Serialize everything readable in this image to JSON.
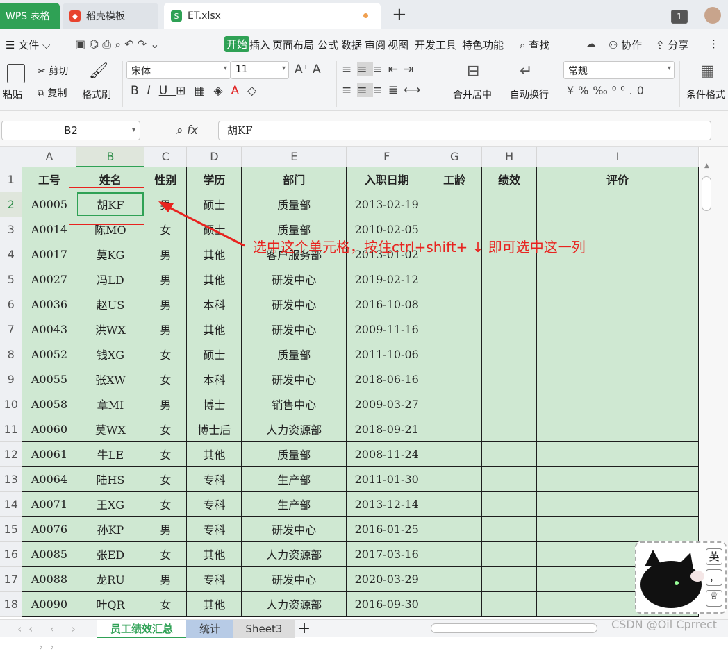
{
  "tabs": [
    {
      "label": "WPS 表格"
    },
    {
      "label": "稻壳模板"
    },
    {
      "label": "ET.xlsx"
    }
  ],
  "tab_counter": "1",
  "menu": {
    "file": "文件",
    "items": [
      "开始",
      "插入",
      "页面布局",
      "公式",
      "数据",
      "审阅",
      "视图",
      "开发工具",
      "特色功能"
    ],
    "search": "查找",
    "collab": "协作",
    "share": "分享"
  },
  "ribbon": {
    "paste": "粘贴",
    "cut": "剪切",
    "copy": "复制",
    "format_painter": "格式刷",
    "font_name": "宋体",
    "font_size": "11",
    "merge": "合并居中",
    "wrap": "自动换行",
    "number_format": "常规",
    "cond_format": "条件格式"
  },
  "formula_bar": {
    "cell_ref": "B2",
    "fx": "fx",
    "value": "胡KF"
  },
  "columns": [
    "A",
    "B",
    "C",
    "D",
    "E",
    "F",
    "G",
    "H",
    "I"
  ],
  "rows": [
    [
      "工号",
      "姓名",
      "性别",
      "学历",
      "部门",
      "入职日期",
      "工龄",
      "绩效",
      "评价"
    ],
    [
      "A0005",
      "胡KF",
      "男",
      "硕士",
      "质量部",
      "2013-02-19",
      "",
      "",
      ""
    ],
    [
      "A0014",
      "陈MO",
      "女",
      "硕士",
      "质量部",
      "2010-02-05",
      "",
      "",
      ""
    ],
    [
      "A0017",
      "莫KG",
      "男",
      "其他",
      "客户服务部",
      "2013-01-02",
      "",
      "",
      ""
    ],
    [
      "A0027",
      "冯LD",
      "男",
      "其他",
      "研发中心",
      "2019-02-12",
      "",
      "",
      ""
    ],
    [
      "A0036",
      "赵US",
      "男",
      "本科",
      "研发中心",
      "2016-10-08",
      "",
      "",
      ""
    ],
    [
      "A0043",
      "洪WX",
      "男",
      "其他",
      "研发中心",
      "2009-11-16",
      "",
      "",
      ""
    ],
    [
      "A0052",
      "钱XG",
      "女",
      "硕士",
      "质量部",
      "2011-10-06",
      "",
      "",
      ""
    ],
    [
      "A0055",
      "张XW",
      "女",
      "本科",
      "研发中心",
      "2018-06-16",
      "",
      "",
      ""
    ],
    [
      "A0058",
      "章MI",
      "男",
      "博士",
      "销售中心",
      "2009-03-27",
      "",
      "",
      ""
    ],
    [
      "A0060",
      "莫WX",
      "女",
      "博士后",
      "人力资源部",
      "2018-09-21",
      "",
      "",
      ""
    ],
    [
      "A0061",
      "牛LE",
      "女",
      "其他",
      "质量部",
      "2008-11-24",
      "",
      "",
      ""
    ],
    [
      "A0064",
      "陆HS",
      "女",
      "专科",
      "生产部",
      "2011-01-30",
      "",
      "",
      ""
    ],
    [
      "A0071",
      "王XG",
      "女",
      "专科",
      "生产部",
      "2013-12-14",
      "",
      "",
      ""
    ],
    [
      "A0076",
      "孙KP",
      "男",
      "专科",
      "研发中心",
      "2016-01-25",
      "",
      "",
      ""
    ],
    [
      "A0085",
      "张ED",
      "女",
      "其他",
      "人力资源部",
      "2017-03-16",
      "",
      "",
      ""
    ],
    [
      "A0088",
      "龙RU",
      "男",
      "专科",
      "研发中心",
      "2020-03-29",
      "",
      "",
      ""
    ],
    [
      "A0090",
      "叶QR",
      "女",
      "其他",
      "人力资源部",
      "2016-09-30",
      "",
      "",
      ""
    ]
  ],
  "sheets": [
    "员工绩效汇总",
    "统计",
    "Sheet3"
  ],
  "annotation": {
    "text": "选中这个单元格，按住ctrl+shift+ ↓  即可选中这一列",
    "color": "#e8231f"
  },
  "ime": {
    "lang": "英",
    "punct": "，"
  },
  "watermark": "CSDN @Oil Cprrect",
  "colors": {
    "accent": "#2fa155",
    "cell_fill": "#cfe8d2",
    "annotation": "#e8231f"
  }
}
